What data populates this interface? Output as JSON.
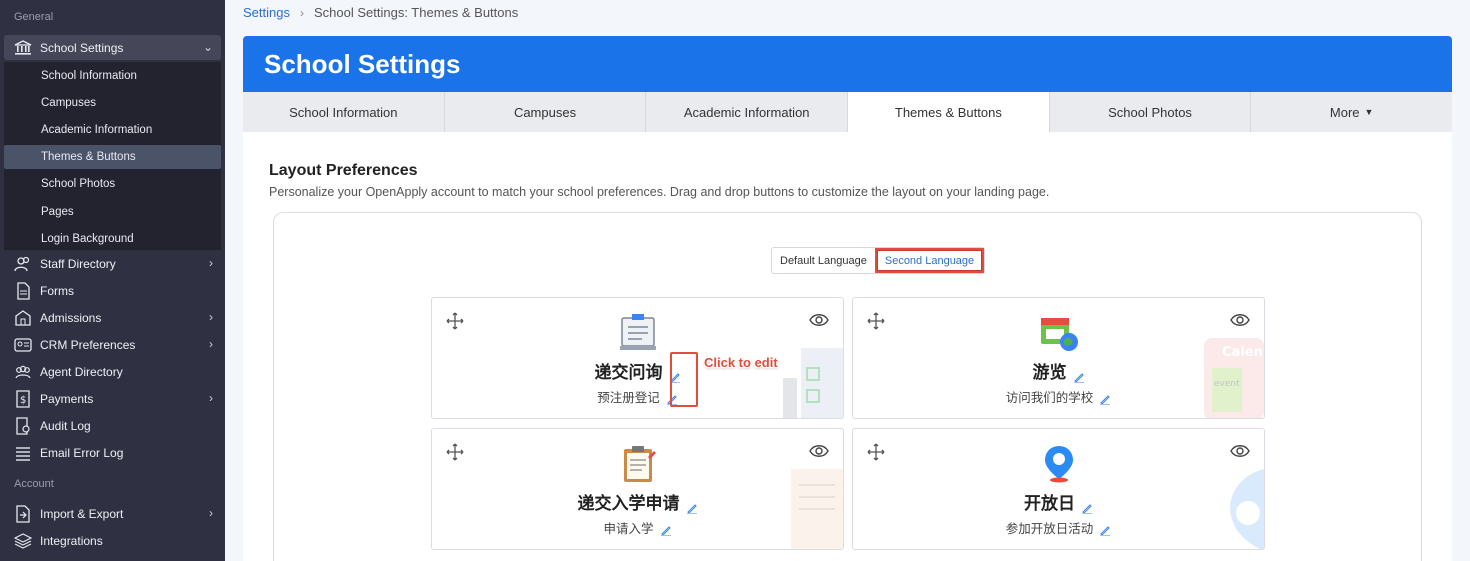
{
  "sidebar": {
    "section_general": "General",
    "section_account": "Account",
    "school_settings": "School Settings",
    "sub_items": [
      "School Information",
      "Campuses",
      "Academic Information",
      "Themes & Buttons",
      "School Photos",
      "Pages",
      "Login Background"
    ],
    "items": [
      "Staff Directory",
      "Forms",
      "Admissions",
      "CRM Preferences",
      "Agent Directory",
      "Payments",
      "Audit Log",
      "Email Error Log"
    ],
    "account_items": [
      "Import & Export",
      "Integrations"
    ]
  },
  "breadcrumb": {
    "root": "Settings",
    "current": "School Settings: Themes & Buttons"
  },
  "header": {
    "title": "School Settings"
  },
  "tabs": [
    "School Information",
    "Campuses",
    "Academic Information",
    "Themes & Buttons",
    "School Photos",
    "More"
  ],
  "layout": {
    "title": "Layout Preferences",
    "description": "Personalize your OpenApply account to match your school preferences. Drag and drop buttons to customize the layout on your landing page."
  },
  "language_toggle": {
    "default": "Default Language",
    "second": "Second Language"
  },
  "cards": [
    {
      "title": "递交问询",
      "subtitle": "预注册登记"
    },
    {
      "title": "游览",
      "subtitle": "访问我们的学校"
    },
    {
      "title": "递交入学申请",
      "subtitle": "申请入学"
    },
    {
      "title": "开放日",
      "subtitle": "参加开放日活动"
    }
  ],
  "annotation": {
    "label": "Click to edit"
  },
  "colors": {
    "header": "#1a73e8",
    "sidebar": "#2f3142",
    "highlight": "#e14d3c"
  }
}
